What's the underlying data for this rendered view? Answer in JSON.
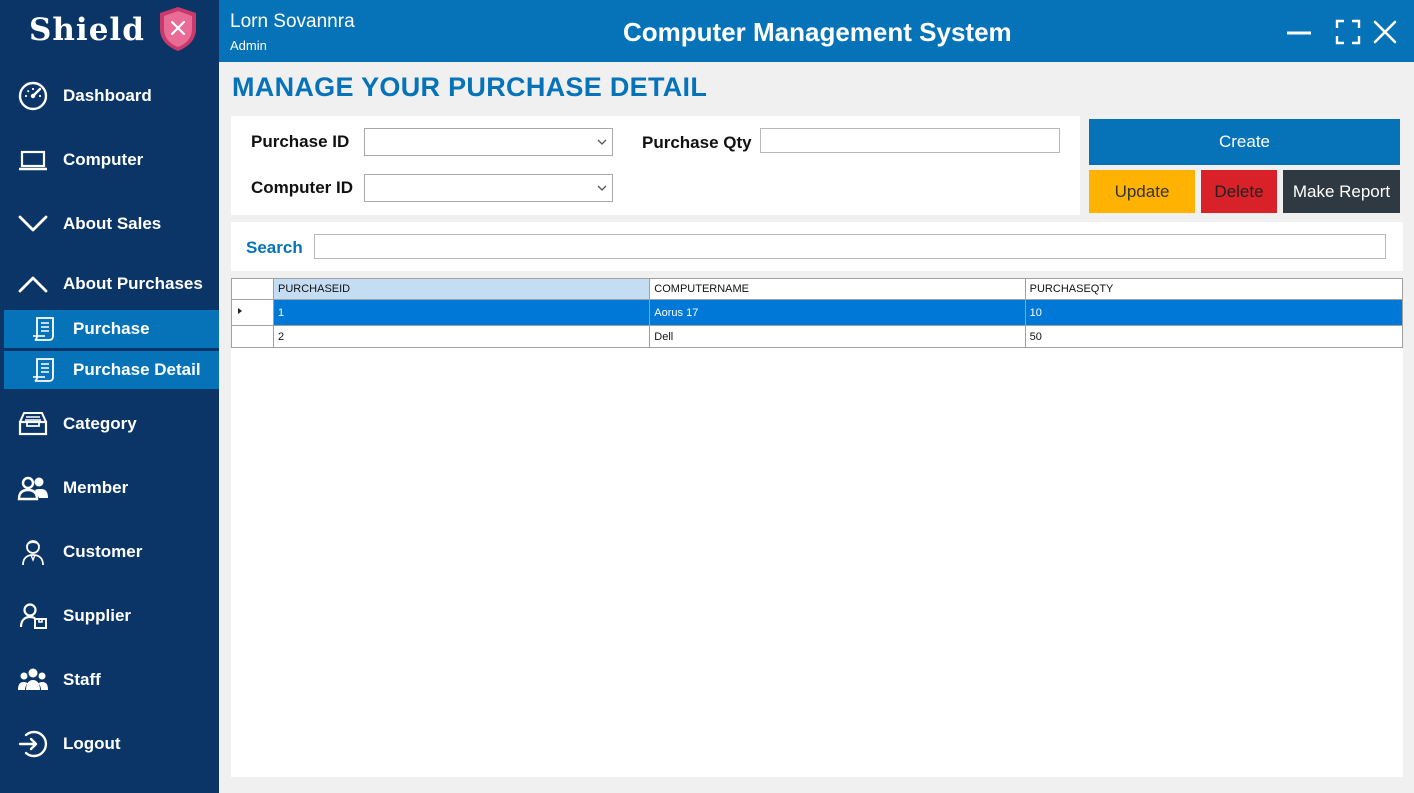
{
  "brand": {
    "name": "Shield",
    "logo_icon": "shield-icon"
  },
  "sidebar": {
    "items": [
      {
        "label": "Dashboard",
        "icon": "dashboard-gauge-icon"
      },
      {
        "label": "Computer",
        "icon": "laptop-icon"
      },
      {
        "label": "About Sales",
        "icon": "chevron-down-icon"
      },
      {
        "label": "About Purchases",
        "icon": "chevron-up-icon"
      },
      {
        "label": "Category",
        "icon": "inbox-tray-icon"
      },
      {
        "label": "Member",
        "icon": "users-icon"
      },
      {
        "label": "Customer",
        "icon": "person-icon"
      },
      {
        "label": "Supplier",
        "icon": "supplier-icon"
      },
      {
        "label": "Staff",
        "icon": "group-icon"
      },
      {
        "label": "Logout",
        "icon": "logout-icon"
      }
    ],
    "sub_items": [
      {
        "label": "Purchase",
        "icon": "document-icon"
      },
      {
        "label": "Purchase Detail",
        "icon": "document-icon"
      }
    ]
  },
  "header": {
    "user_name": "Lorn Sovannra",
    "user_role": "Admin",
    "app_title": "Computer Management System"
  },
  "main": {
    "page_title": "MANAGE YOUR PURCHASE DETAIL",
    "form": {
      "purchase_id_label": "Purchase ID",
      "purchase_id_value": "",
      "computer_id_label": "Computer ID",
      "computer_id_value": "",
      "purchase_qty_label": "Purchase Qty",
      "purchase_qty_value": ""
    },
    "buttons": {
      "create": "Create",
      "update": "Update",
      "delete": "Delete",
      "report": "Make Report"
    },
    "search": {
      "label": "Search",
      "value": ""
    },
    "grid": {
      "columns": [
        "PURCHASEID",
        "COMPUTERNAME",
        "PURCHASEQTY"
      ],
      "rows": [
        [
          "1",
          "Aorus 17",
          "10"
        ],
        [
          "2",
          "Dell",
          "50"
        ]
      ],
      "selected_row": 0
    }
  },
  "colors": {
    "sidebar_bg": "#0a3566",
    "accent": "#0673b8",
    "update": "#ffb300",
    "delete": "#d82128",
    "report": "#2f3941",
    "row_selected": "#0078d7"
  }
}
